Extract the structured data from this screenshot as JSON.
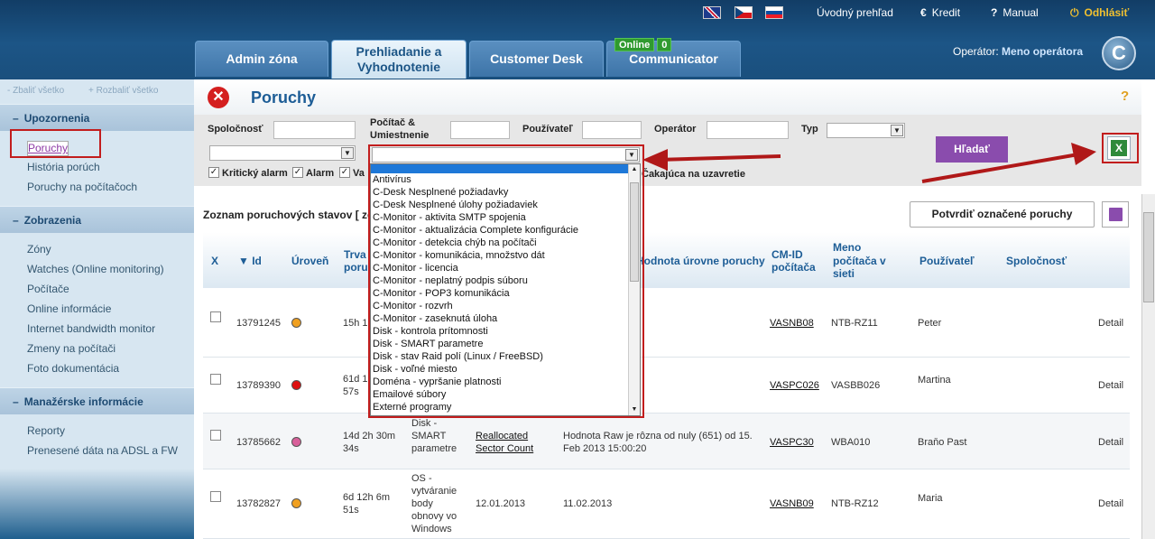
{
  "header": {
    "flags": [
      "uk-flag",
      "cz-flag",
      "sk-flag"
    ],
    "links": {
      "overview": "Úvodný prehľad",
      "credit": "Kredit",
      "manual": "Manual",
      "logout": "Odhlásiť"
    },
    "tabs": [
      {
        "label": "Admin zóna"
      },
      {
        "label": "Prehliadanie a Vyhodnotenie"
      },
      {
        "label": "Customer Desk"
      },
      {
        "label": "Communicator"
      }
    ],
    "online": {
      "label": "Online",
      "count": "0"
    },
    "operator": {
      "label": "Operátor:",
      "name": "Meno operátora"
    },
    "logo_letter": "C"
  },
  "sidebar": {
    "collapse": "- Zbaliť všetko",
    "expand": "+ Rozbaliť všetko",
    "sections": [
      {
        "title": "Upozornenia",
        "items": [
          "Poruchy",
          "História porúch",
          "Poruchy na počítačoch"
        ]
      },
      {
        "title": "Zobrazenia",
        "items": [
          "Zóny",
          "Watches (Online monitoring)",
          "Počítače",
          "Online informácie",
          "Internet bandwidth monitor",
          "Zmeny na počítači",
          "Foto dokumentácia"
        ]
      },
      {
        "title": "Manažérske informácie",
        "items": [
          "Reporty",
          "Prenesené dáta na ADSL a FW"
        ]
      }
    ]
  },
  "page": {
    "title": "Poruchy",
    "help": "?"
  },
  "filters": {
    "company": "Spoločnosť",
    "computer": "Počítač &",
    "location": "Umiestnenie",
    "user": "Používateľ",
    "operator": "Operátor",
    "type": "Typ",
    "search": "Hľadať",
    "checks": [
      {
        "label": "Kritický alarm",
        "checked": true
      },
      {
        "label": "Alarm",
        "checked": true
      },
      {
        "label": "Va",
        "checked": true
      }
    ],
    "waiting": "Čakajúca na uzavretie"
  },
  "list": {
    "title": "Zoznam poruchových stavov [ zo",
    "confirm": "Potvrdiť označené poruchy",
    "columns": [
      "X",
      "Id",
      "Úroveň",
      "Trva",
      "poru",
      "Hodnota úrovne poruchy",
      "CM-ID",
      "počítača",
      "Meno",
      "počítača v",
      "sieti",
      "Používateľ",
      "Spoločnosť"
    ],
    "rows": [
      {
        "id": "13791245",
        "level_color": "#f0a020",
        "duration": "15h 1",
        "type": "",
        "param": "",
        "value": "",
        "cmid": "VASNB08",
        "name": "NTB-RZ11",
        "user": "Peter",
        "detail": "Detail"
      },
      {
        "id": "13789390",
        "level_color": "#dd1111",
        "duration": "61d 1",
        "duration2": "57s",
        "type": "",
        "param": "",
        "value": "",
        "cmid": "VASPC026",
        "name": "VASBB026",
        "user": "Martina",
        "detail": "Detail"
      },
      {
        "id": "13785662",
        "level_color": "#d8609a",
        "duration": "14d 2h 30m",
        "duration2": "34s",
        "type": "Disk -",
        "type2": "SMART",
        "type3": "parametre",
        "param": "Reallocated",
        "param2": "Sector Count",
        "value": "Hodnota Raw je rôzna od nuly (651) od 15.",
        "value2": "Feb 2013 15:00:20",
        "cmid": "VASPC30",
        "name": "WBA010",
        "user": "Braňo Past",
        "detail": "Detail"
      },
      {
        "id": "13782827",
        "level_color": "#f0a020",
        "duration": "6d 12h 6m",
        "duration2": "51s",
        "type": "OS -",
        "type2": "vytváranie",
        "type3": "body",
        "type4": "obnovy vo",
        "type5": "Windows",
        "param": "12.01.2013",
        "value": "11.02.2013",
        "cmid": "VASNB09",
        "name": "NTB-RZ12",
        "user": "Maria",
        "detail": "Detail"
      }
    ]
  },
  "dropdown": {
    "options": [
      "Antivírus",
      "C-Desk Nesplnené požiadavky",
      "C-Desk Nesplnené úlohy požiadaviek",
      "C-Monitor - aktivita SMTP spojenia",
      "C-Monitor - aktualizácia Complete konfigurácie",
      "C-Monitor - detekcia chýb na počítači",
      "C-Monitor - komunikácia, množstvo dát",
      "C-Monitor - licencia",
      "C-Monitor - neplatný podpis súboru",
      "C-Monitor - POP3 komunikácia",
      "C-Monitor - rozvrh",
      "C-Monitor - zaseknutá úloha",
      "Disk - kontrola prítomnosti",
      "Disk - SMART parametre",
      "Disk - stav Raid polí (Linux / FreeBSD)",
      "Disk - voľné miesto",
      "Doména - vypršanie platnosti",
      "Emailové súbory",
      "Externé programy"
    ]
  },
  "colors": {
    "accent": "#8a4cad",
    "highlight": "#c21d1d",
    "header": "#1c5586"
  }
}
